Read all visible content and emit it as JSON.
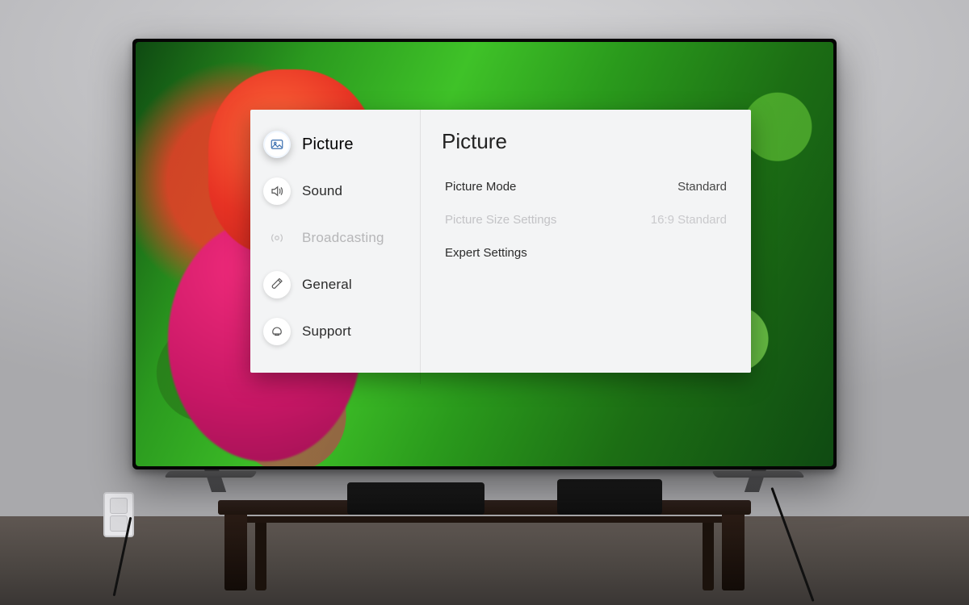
{
  "sidebar": {
    "items": [
      {
        "label": "Picture",
        "icon": "picture-icon",
        "selected": true,
        "disabled": false
      },
      {
        "label": "Sound",
        "icon": "sound-icon",
        "selected": false,
        "disabled": false
      },
      {
        "label": "Broadcasting",
        "icon": "broadcast-icon",
        "selected": false,
        "disabled": true
      },
      {
        "label": "General",
        "icon": "general-icon",
        "selected": false,
        "disabled": false
      },
      {
        "label": "Support",
        "icon": "support-icon",
        "selected": false,
        "disabled": false
      }
    ]
  },
  "content": {
    "title": "Picture",
    "rows": [
      {
        "label": "Picture Mode",
        "value": "Standard",
        "disabled": false
      },
      {
        "label": "Picture Size Settings",
        "value": "16:9 Standard",
        "disabled": true
      },
      {
        "label": "Expert Settings",
        "value": "",
        "disabled": false
      }
    ]
  }
}
